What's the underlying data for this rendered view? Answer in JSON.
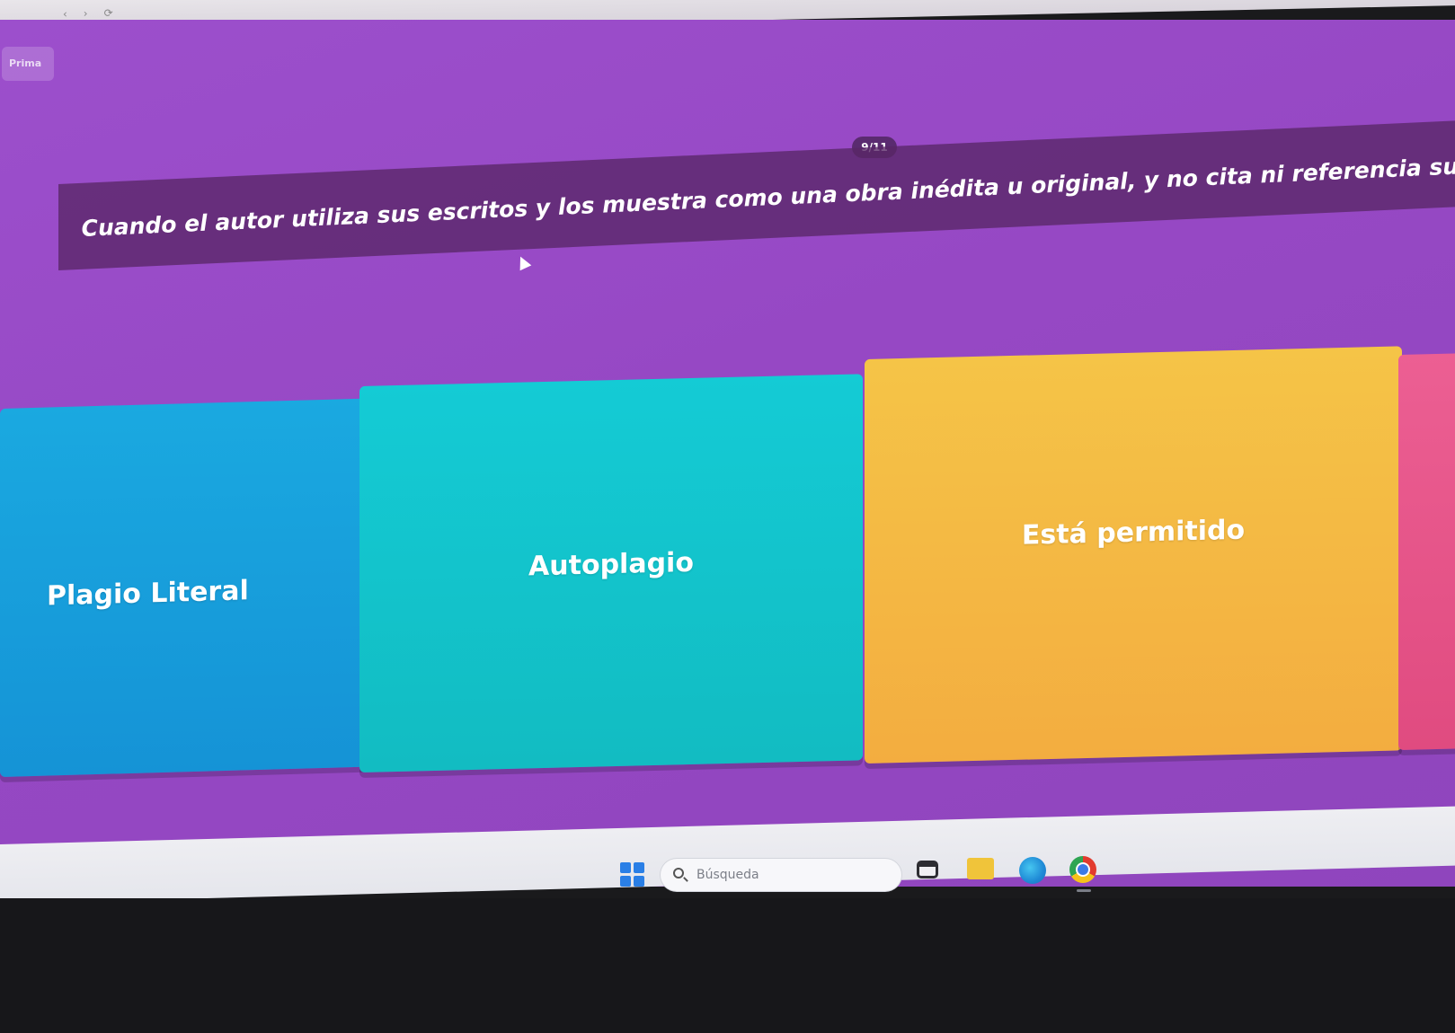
{
  "quiz": {
    "badge": "Prima",
    "counter": "9/11",
    "question": "Cuando el autor utiliza sus escritos y los muestra como una obra inédita u original, y no cita ni referencia sus publica",
    "answers": [
      {
        "label": "Plagio Literal",
        "color": "#1593d6"
      },
      {
        "label": "Autoplagio",
        "color": "#12bcc2"
      },
      {
        "label": "Está permitido",
        "color": "#f3ad40"
      },
      {
        "label": "",
        "color": "#e04b80"
      }
    ]
  },
  "taskbar": {
    "search_placeholder": "Búsqueda",
    "icons": [
      "windows-start-icon",
      "search-icon",
      "task-view-icon",
      "file-explorer-icon",
      "edge-icon",
      "chrome-icon"
    ]
  },
  "colors": {
    "background": "#9648c4",
    "question_bar": "#582666"
  }
}
